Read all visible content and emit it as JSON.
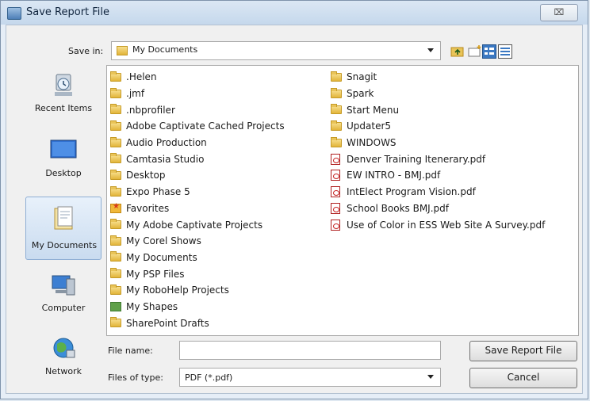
{
  "window": {
    "title": "Save Report File",
    "close_glyph": "⌧"
  },
  "toolbar": {
    "save_in_label": "Save in:",
    "save_in_value": "My Documents"
  },
  "places": [
    {
      "label": "Recent Items",
      "icon": "recent-items-icon"
    },
    {
      "label": "Desktop",
      "icon": "desktop-icon"
    },
    {
      "label": "My Documents",
      "icon": "my-documents-icon",
      "selected": true
    },
    {
      "label": "Computer",
      "icon": "computer-icon"
    },
    {
      "label": "Network",
      "icon": "network-icon"
    }
  ],
  "files": {
    "column1": [
      {
        "name": ".Helen",
        "icon": "folder"
      },
      {
        "name": ".jmf",
        "icon": "folder"
      },
      {
        "name": ".nbprofiler",
        "icon": "folder"
      },
      {
        "name": "Adobe Captivate Cached Projects",
        "icon": "folder"
      },
      {
        "name": "Audio Production",
        "icon": "folder"
      },
      {
        "name": "Camtasia Studio",
        "icon": "folder"
      },
      {
        "name": "Desktop",
        "icon": "folder"
      },
      {
        "name": "Expo Phase 5",
        "icon": "folder"
      },
      {
        "name": "Favorites",
        "icon": "favorites"
      },
      {
        "name": "My Adobe Captivate Projects",
        "icon": "folder"
      },
      {
        "name": "My Corel Shows",
        "icon": "folder"
      },
      {
        "name": "My Documents",
        "icon": "folder"
      },
      {
        "name": "My PSP Files",
        "icon": "folder"
      },
      {
        "name": "My RoboHelp Projects",
        "icon": "folder"
      },
      {
        "name": "My Shapes",
        "icon": "shapes"
      },
      {
        "name": "SharePoint Drafts",
        "icon": "folder"
      }
    ],
    "column2": [
      {
        "name": "Snagit",
        "icon": "folder"
      },
      {
        "name": "Spark",
        "icon": "folder"
      },
      {
        "name": "Start Menu",
        "icon": "folder"
      },
      {
        "name": "Updater5",
        "icon": "folder"
      },
      {
        "name": "WINDOWS",
        "icon": "folder"
      },
      {
        "name": "Denver Training Itenerary.pdf",
        "icon": "pdf"
      },
      {
        "name": "EW INTRO - BMJ.pdf",
        "icon": "pdf"
      },
      {
        "name": "IntElect Program Vision.pdf",
        "icon": "pdf"
      },
      {
        "name": "School Books BMJ.pdf",
        "icon": "pdf"
      },
      {
        "name": "Use of Color in ESS Web Site A Survey.pdf",
        "icon": "pdf"
      }
    ]
  },
  "bottom": {
    "file_name_label": "File name:",
    "file_name_value": "",
    "file_type_label": "Files of type:",
    "file_type_value": "PDF (*.pdf)",
    "save_button": "Save Report File",
    "cancel_button": "Cancel"
  }
}
